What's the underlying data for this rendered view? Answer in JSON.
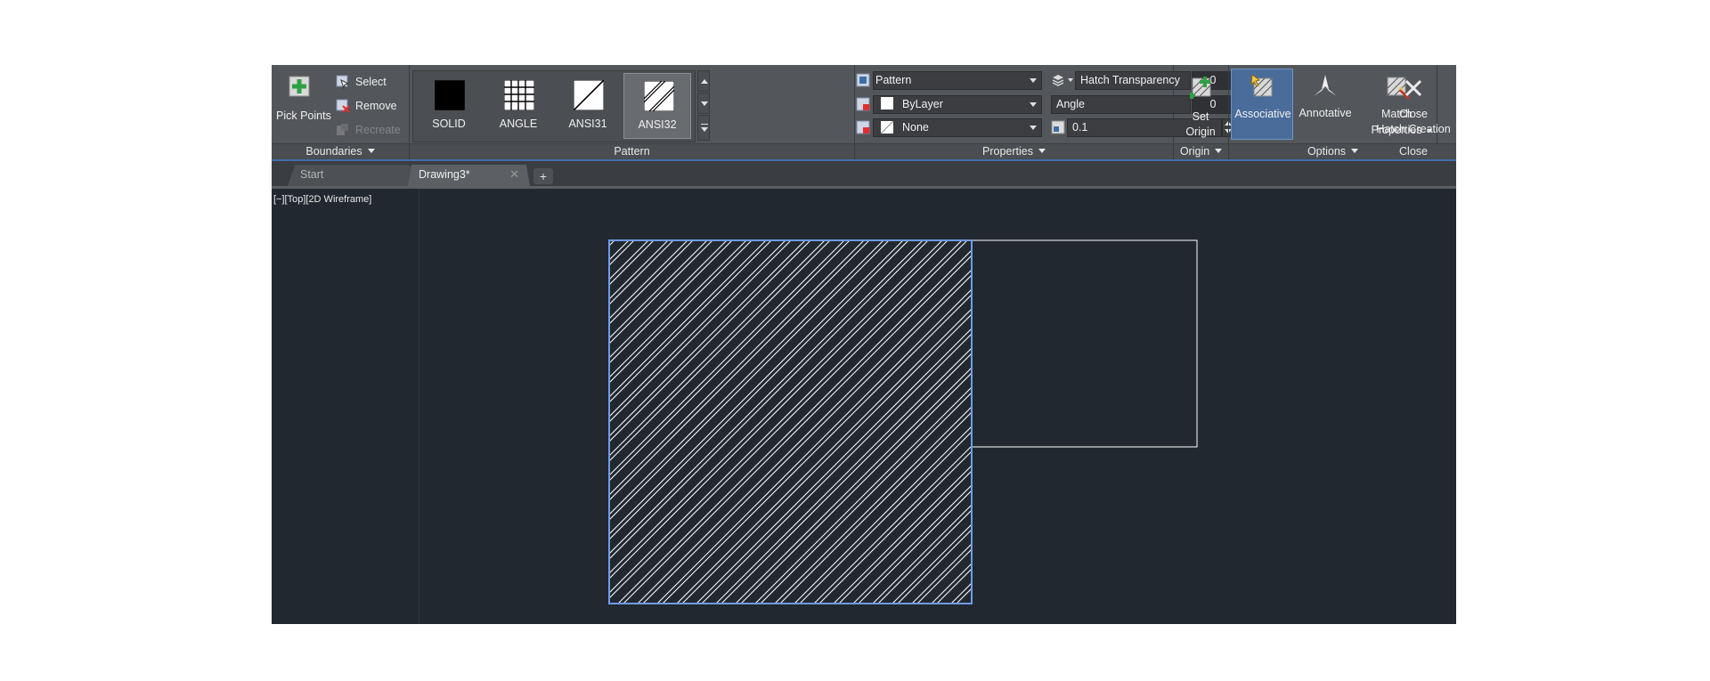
{
  "ribbon": {
    "boundaries": {
      "pick_points": "Pick Points",
      "select": "Select",
      "remove": "Remove",
      "recreate": "Recreate",
      "title": "Boundaries"
    },
    "pattern": {
      "title": "Pattern",
      "swatches": [
        {
          "name": "SOLID",
          "selected": false
        },
        {
          "name": "ANGLE",
          "selected": false
        },
        {
          "name": "ANSI31",
          "selected": false
        },
        {
          "name": "ANSI32",
          "selected": true
        }
      ]
    },
    "properties": {
      "title": "Properties",
      "hatch_type": "Pattern",
      "color": "ByLayer",
      "background": "None",
      "transparency_label": "Hatch Transparency",
      "transparency_value": "0",
      "angle_label": "Angle",
      "angle_value": "0",
      "scale_value": "0.1"
    },
    "origin": {
      "set_origin_line1": "Set",
      "set_origin_line2": "Origin",
      "title": "Origin"
    },
    "options": {
      "associative": "Associative",
      "annotative": "Annotative",
      "match_line1": "Match",
      "match_line2": "Properties",
      "title": "Options"
    },
    "close": {
      "close_line1": "Close",
      "close_line2": "Hatch Creation",
      "title": "Close"
    }
  },
  "tabs": {
    "start": "Start",
    "drawing": "Drawing3*",
    "close_glyph": "✕",
    "add_glyph": "+"
  },
  "viewport": {
    "label": "[−][Top][2D Wireframe]"
  },
  "colors": {
    "selection": "#6f9be8",
    "linework": "#ffffff",
    "hatch": "#ffffff",
    "canvas": "#212830"
  }
}
